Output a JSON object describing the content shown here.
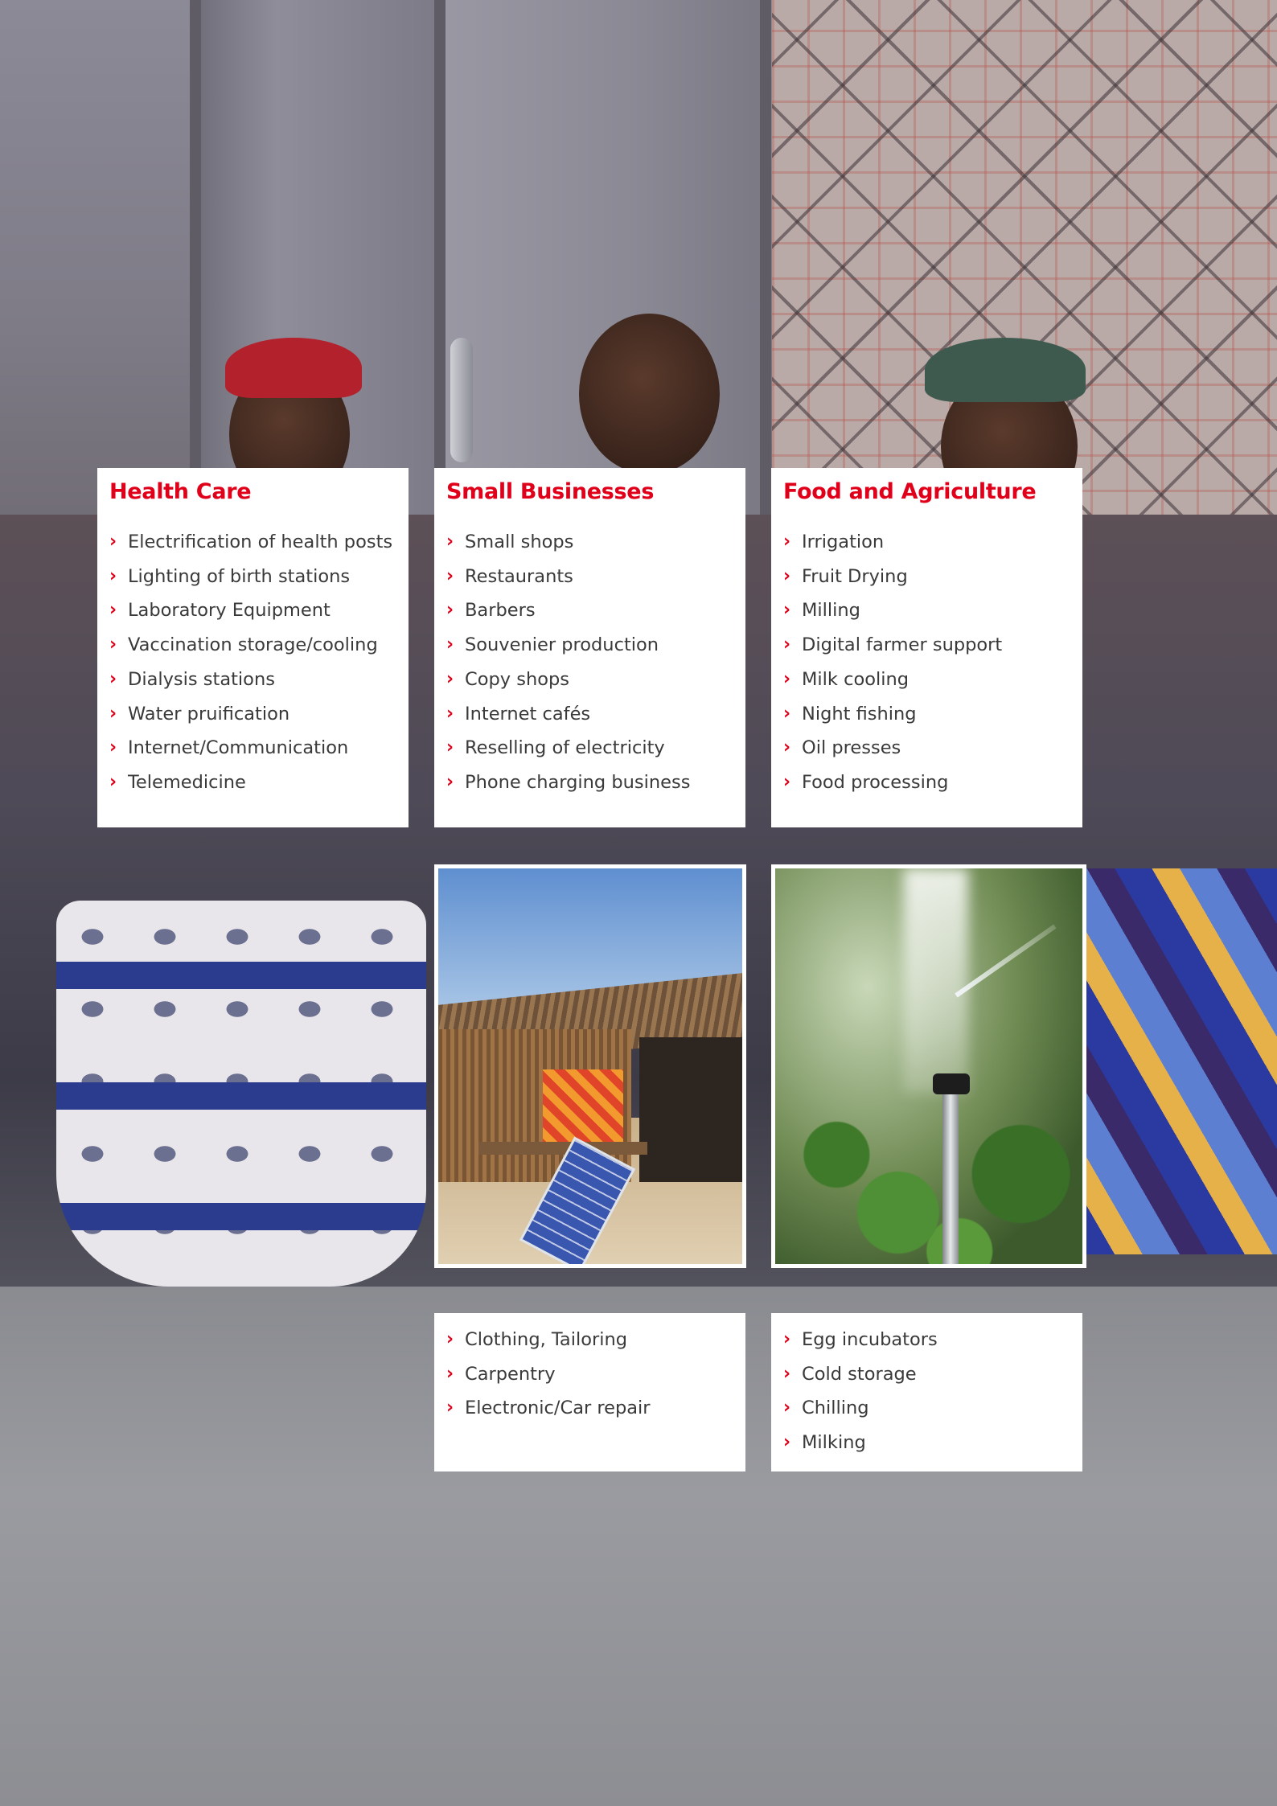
{
  "health_care": {
    "title": "Health Care",
    "items": [
      "Electrification of health posts",
      "Lighting of birth stations",
      "Laboratory Equipment",
      "Vaccination storage/cooling",
      "Dialysis stations",
      "Water pruification",
      "Internet/Communication",
      "Telemedicine"
    ]
  },
  "small_businesses": {
    "title": "Small Businesses",
    "items": [
      "Small shops",
      "Restaurants",
      "Barbers",
      "Souvenier production",
      "Copy shops",
      "Internet cafés",
      "Reselling of electricity",
      "Phone charging business"
    ],
    "more_items": [
      "Clothing, Tailoring",
      "Carpentry",
      "Electronic/Car repair"
    ]
  },
  "food_agriculture": {
    "title": "Food and Agriculture",
    "items": [
      "Irrigation",
      "Fruit Drying",
      "Milling",
      "Digital farmer support",
      "Milk cooling",
      "Night fishing",
      "Oil presses",
      "Food processing"
    ],
    "more_items": [
      "Egg incubators",
      "Cold storage",
      "Chilling",
      "Milking"
    ]
  },
  "bullet_glyph": "›",
  "colors": {
    "accent": "#e1001a",
    "text": "#3a3a3a",
    "card": "#ffffff"
  }
}
